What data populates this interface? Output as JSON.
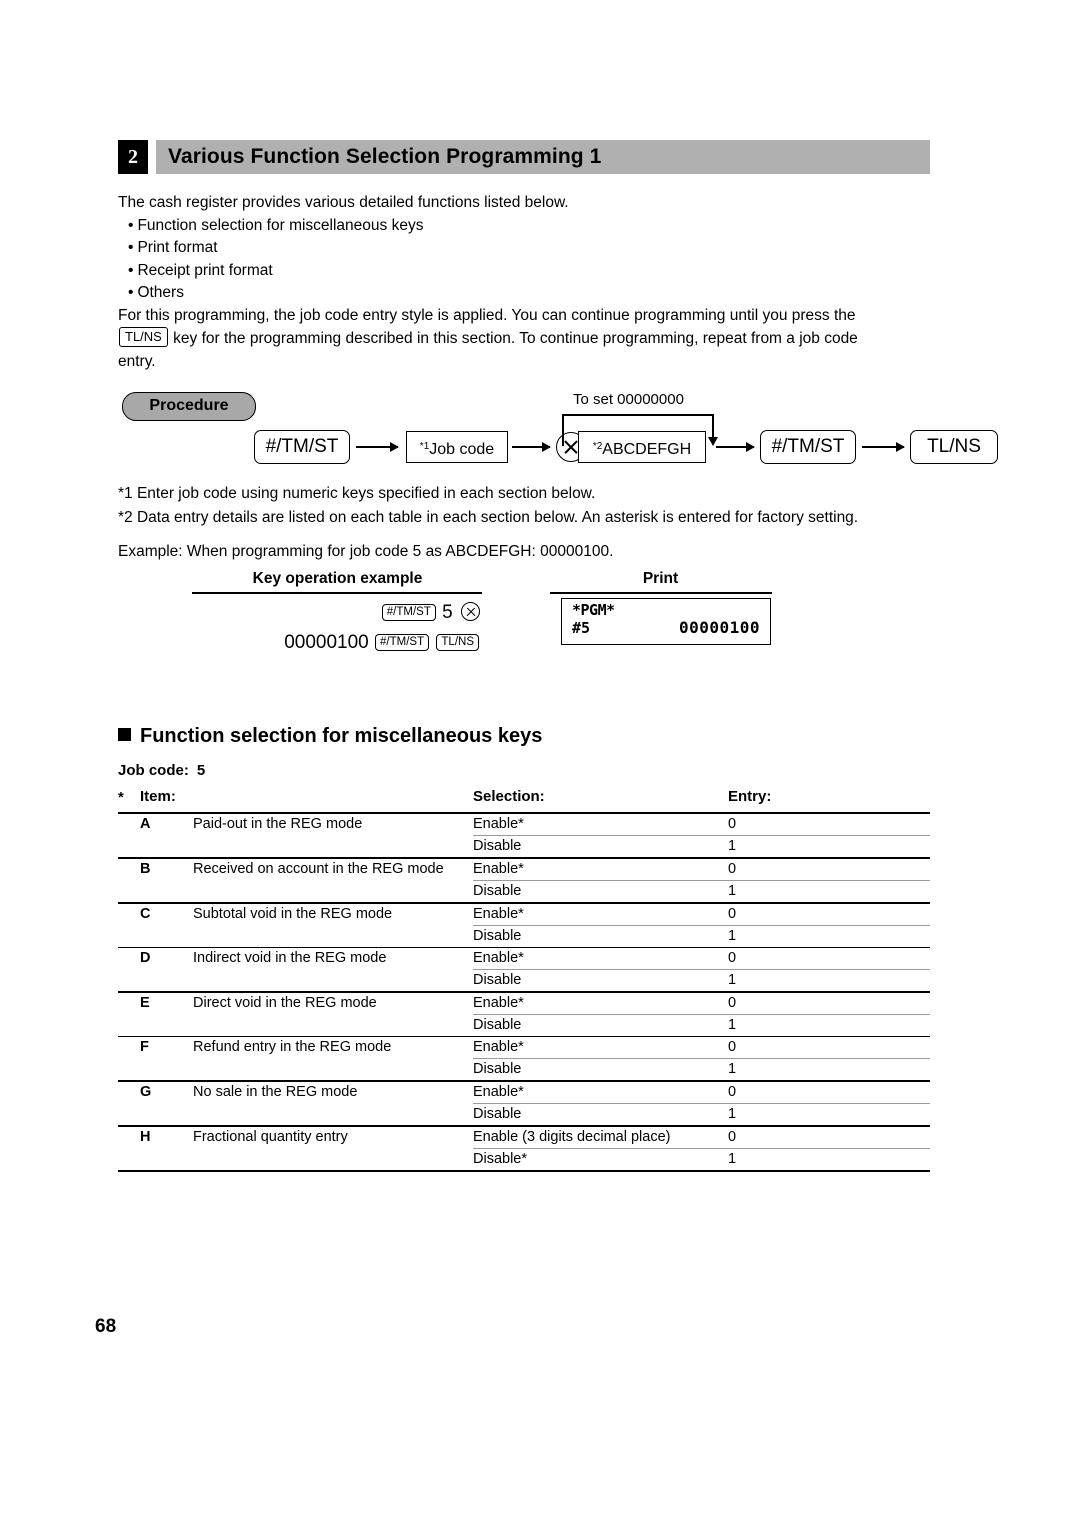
{
  "section": {
    "number": "2",
    "title": "Various Function Selection Programming 1"
  },
  "intro": {
    "lead": "The cash register provides various detailed functions listed below.",
    "bullets": [
      "Function selection for miscellaneous keys",
      "Print format",
      "Receipt print format",
      "Others"
    ],
    "paragraph_part1": "For this programming, the job code entry style is applied.  You can continue programming until you press the",
    "inline_key": "TL/NS",
    "paragraph_part2": "key for the programming described in this section.  To continue programming, repeat from a job code",
    "paragraph_part3": "entry."
  },
  "procedure": {
    "badge": "Procedure",
    "loop_label": "To set  00000000",
    "steps": [
      {
        "label": "#/TM/ST",
        "shape": "round"
      },
      {
        "label": "Job code",
        "sup": "*1",
        "shape": "rect"
      },
      {
        "label": "multiply-key",
        "shape": "circle-x"
      },
      {
        "label": "ABCDEFGH",
        "sup": "*2",
        "shape": "rect"
      },
      {
        "label": "#/TM/ST",
        "shape": "round"
      },
      {
        "label": "TL/NS",
        "shape": "round"
      }
    ]
  },
  "footnotes": {
    "note1": "*1  Enter job code using numeric keys specified in each section below.",
    "note2": "*2  Data entry details are listed on each table in each section below.  An asterisk is entered for factory setting."
  },
  "example": {
    "line": "Example:  When programming for job code 5 as ABCDEFGH: 00000100.",
    "key_operation_heading": "Key operation example",
    "print_heading": "Print",
    "keys_row1": {
      "key1": "#/TM/ST",
      "digit": "5",
      "multiply": "multiply-key"
    },
    "keys_row2": {
      "value": "00000100",
      "key1": "#/TM/ST",
      "key2": "TL/NS"
    },
    "print": {
      "line1": "*PGM*",
      "line2_left": "#5",
      "line2_right": "00000100"
    }
  },
  "subsection": {
    "title": "Function selection for miscellaneous keys",
    "job_code_label": "Job code:",
    "job_code_value": "5"
  },
  "table": {
    "headers": {
      "star": "*",
      "item": "Item:",
      "selection": "Selection:",
      "entry": "Entry:"
    },
    "rows": [
      {
        "letter": "A",
        "item": "Paid-out in the REG mode",
        "options": [
          {
            "selection": "Enable*",
            "entry": "0"
          },
          {
            "selection": "Disable",
            "entry": "1"
          }
        ]
      },
      {
        "letter": "B",
        "item": "Received on account in the REG mode",
        "options": [
          {
            "selection": "Enable*",
            "entry": "0"
          },
          {
            "selection": "Disable",
            "entry": "1"
          }
        ]
      },
      {
        "letter": "C",
        "item": "Subtotal void in the REG mode",
        "options": [
          {
            "selection": "Enable*",
            "entry": "0"
          },
          {
            "selection": "Disable",
            "entry": "1"
          }
        ]
      },
      {
        "letter": "D",
        "item": "Indirect void in the REG mode",
        "options": [
          {
            "selection": "Enable*",
            "entry": "0"
          },
          {
            "selection": "Disable",
            "entry": "1"
          }
        ]
      },
      {
        "letter": "E",
        "item": "Direct void in the REG mode",
        "options": [
          {
            "selection": "Enable*",
            "entry": "0"
          },
          {
            "selection": "Disable",
            "entry": "1"
          }
        ]
      },
      {
        "letter": "F",
        "item": "Refund entry in the REG mode",
        "options": [
          {
            "selection": "Enable*",
            "entry": "0"
          },
          {
            "selection": "Disable",
            "entry": "1"
          }
        ]
      },
      {
        "letter": "G",
        "item": "No sale in the REG mode",
        "options": [
          {
            "selection": "Enable*",
            "entry": "0"
          },
          {
            "selection": "Disable",
            "entry": "1"
          }
        ]
      },
      {
        "letter": "H",
        "item": "Fractional quantity entry",
        "options": [
          {
            "selection": "Enable (3 digits decimal place)",
            "entry": "0"
          },
          {
            "selection": "Disable*",
            "entry": "1"
          }
        ]
      }
    ]
  },
  "page_number": "68",
  "colors": {
    "banner": "#b0b0b0",
    "badge": "#a8a8a8",
    "rule": "#000000",
    "subrule": "#9a9a9a"
  }
}
